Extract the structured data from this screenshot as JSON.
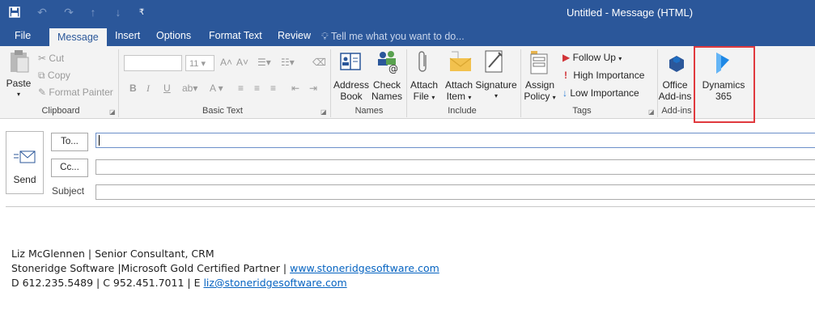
{
  "window": {
    "title": "Untitled - Message (HTML)"
  },
  "quick_access": {
    "save_icon": "save-icon",
    "undo_icon": "undo-icon",
    "redo_icon": "redo-icon",
    "up_icon": "up-arrow-icon",
    "down_icon": "down-arrow-icon",
    "customize_icon": "customize-dropdown-icon"
  },
  "tabs": [
    "File",
    "Message",
    "Insert",
    "Options",
    "Format Text",
    "Review"
  ],
  "tell_me": "Tell me what you want to do...",
  "ribbon": {
    "clipboard": {
      "paste": "Paste",
      "cut": "Cut",
      "copy": "Copy",
      "format_painter": "Format Painter",
      "label": "Clipboard"
    },
    "basic_text": {
      "font_size": "11",
      "bold": "B",
      "italic": "I",
      "underline": "U",
      "label": "Basic Text"
    },
    "names": {
      "address_book_1": "Address",
      "address_book_2": "Book",
      "check_names_1": "Check",
      "check_names_2": "Names",
      "label": "Names"
    },
    "include": {
      "attach_file_1": "Attach",
      "attach_file_2": "File",
      "attach_item_1": "Attach",
      "attach_item_2": "Item",
      "signature": "Signature",
      "label": "Include"
    },
    "tags": {
      "assign_policy_1": "Assign",
      "assign_policy_2": "Policy",
      "follow_up": "Follow Up",
      "high_importance": "High Importance",
      "low_importance": "Low Importance",
      "label": "Tags"
    },
    "addins": {
      "office_addins_1": "Office",
      "office_addins_2": "Add-ins",
      "dynamics_1": "Dynamics",
      "dynamics_2": "365",
      "label": "Add-ins"
    }
  },
  "compose": {
    "send": "Send",
    "to": "To...",
    "cc": "Cc...",
    "subject": "Subject",
    "to_value": "",
    "cc_value": "",
    "subject_value": ""
  },
  "signature": {
    "line1": "Liz McGlennen | Senior Consultant, CRM",
    "line2_prefix": "Stoneridge Software |Microsoft Gold Certified Partner | ",
    "line2_link": "www.stoneridgesoftware.com",
    "line3_prefix": "D 612.235.5489 | C 952.451.7011 | E ",
    "line3_link": "liz@stoneridgesoftware.com"
  },
  "colors": {
    "titlebar": "#2b579a",
    "ribbon": "#f3f3f3",
    "highlight": "#e0393e",
    "link": "#0563c1",
    "dynamics": "#1e88e5"
  }
}
